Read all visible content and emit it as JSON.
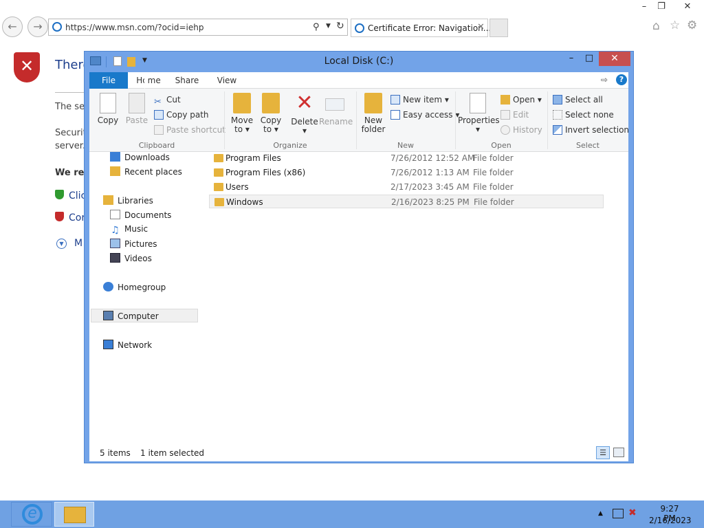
{
  "ie": {
    "address": "https://www.msn.com/?ocid=iehp",
    "tab_title": "Certificate Error: Navigation...",
    "error": {
      "heading": "There",
      "line1": "The se",
      "line2": "Securit",
      "line3": "server.",
      "line4": "We rec",
      "link1": "Clic",
      "link2": "Cor",
      "more": "M"
    }
  },
  "explorer": {
    "title": "Local Disk (C:)",
    "tabs": {
      "file": "File",
      "home": "Home",
      "share": "Share",
      "view": "View"
    },
    "ribbon": {
      "clipboard": {
        "label": "Clipboard",
        "copy": "Copy",
        "paste": "Paste",
        "cut": "Cut",
        "copy_path": "Copy path",
        "paste_shortcut": "Paste shortcut"
      },
      "organize": {
        "label": "Organize",
        "move_to": "Move",
        "move_to2": "to",
        "copy_to": "Copy",
        "copy_to2": "to",
        "delete": "Delete",
        "rename": "Rename"
      },
      "new": {
        "label": "New",
        "new_folder": "New",
        "new_folder2": "folder",
        "new_item": "New item",
        "easy_access": "Easy access"
      },
      "open": {
        "label": "Open",
        "properties": "Properties",
        "open": "Open",
        "edit": "Edit",
        "history": "History"
      },
      "select": {
        "label": "Select",
        "select_all": "Select all",
        "select_none": "Select none",
        "invert": "Invert selection"
      }
    },
    "nav": {
      "downloads": "Downloads",
      "recent": "Recent places",
      "libraries": "Libraries",
      "documents": "Documents",
      "music": "Music",
      "pictures": "Pictures",
      "videos": "Videos",
      "homegroup": "Homegroup",
      "computer": "Computer",
      "network": "Network"
    },
    "files": [
      {
        "name": "Program Files",
        "date": "7/26/2012 12:52 AM",
        "type": "File folder"
      },
      {
        "name": "Program Files (x86)",
        "date": "7/26/2012 1:13 AM",
        "type": "File folder"
      },
      {
        "name": "Users",
        "date": "2/17/2023 3:45 AM",
        "type": "File folder"
      },
      {
        "name": "Windows",
        "date": "2/16/2023 8:25 PM",
        "type": "File folder"
      }
    ],
    "status": {
      "items": "5 items",
      "selected": "1 item selected"
    }
  },
  "taskbar": {
    "time": "9:27 PM",
    "date": "2/16/2023"
  },
  "colors": {
    "accent": "#1979ca",
    "window_frame": "#72a3e8",
    "taskbar": "#6fa1e3",
    "close": "#c74f4f"
  }
}
